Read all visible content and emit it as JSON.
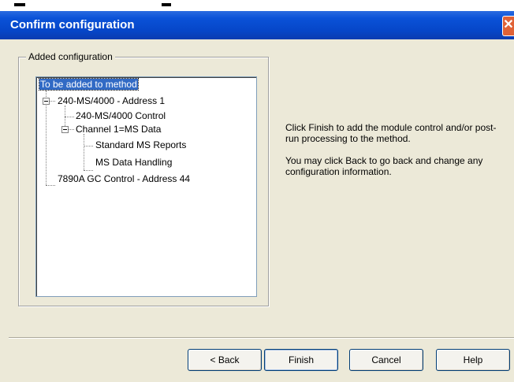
{
  "dialog": {
    "title": "Confirm configuration",
    "close_glyph": "✕"
  },
  "group": {
    "label": "Added configuration"
  },
  "tree": {
    "root": "To be added to method",
    "ms_address": "240-MS/4000 - Address 1",
    "ms_control": "240-MS/4000 Control",
    "channel": "Channel 1=MS Data",
    "standard_reports": "Standard MS Reports",
    "data_handling": "MS Data Handling",
    "gc_control": "7890A GC Control - Address 44"
  },
  "info": {
    "line1": "Click Finish to add the module control and/or post-run processing to the method.",
    "line2": "You may click Back to go back and change any configuration information."
  },
  "buttons": {
    "back": "< Back",
    "finish": "Finish",
    "cancel": "Cancel",
    "help": "Help"
  },
  "icons": [
    "close-icon",
    "tree-expander-icon"
  ],
  "colors": {
    "titlebar": "#0a52d8",
    "selection": "#316ac5",
    "close": "#e06236"
  }
}
